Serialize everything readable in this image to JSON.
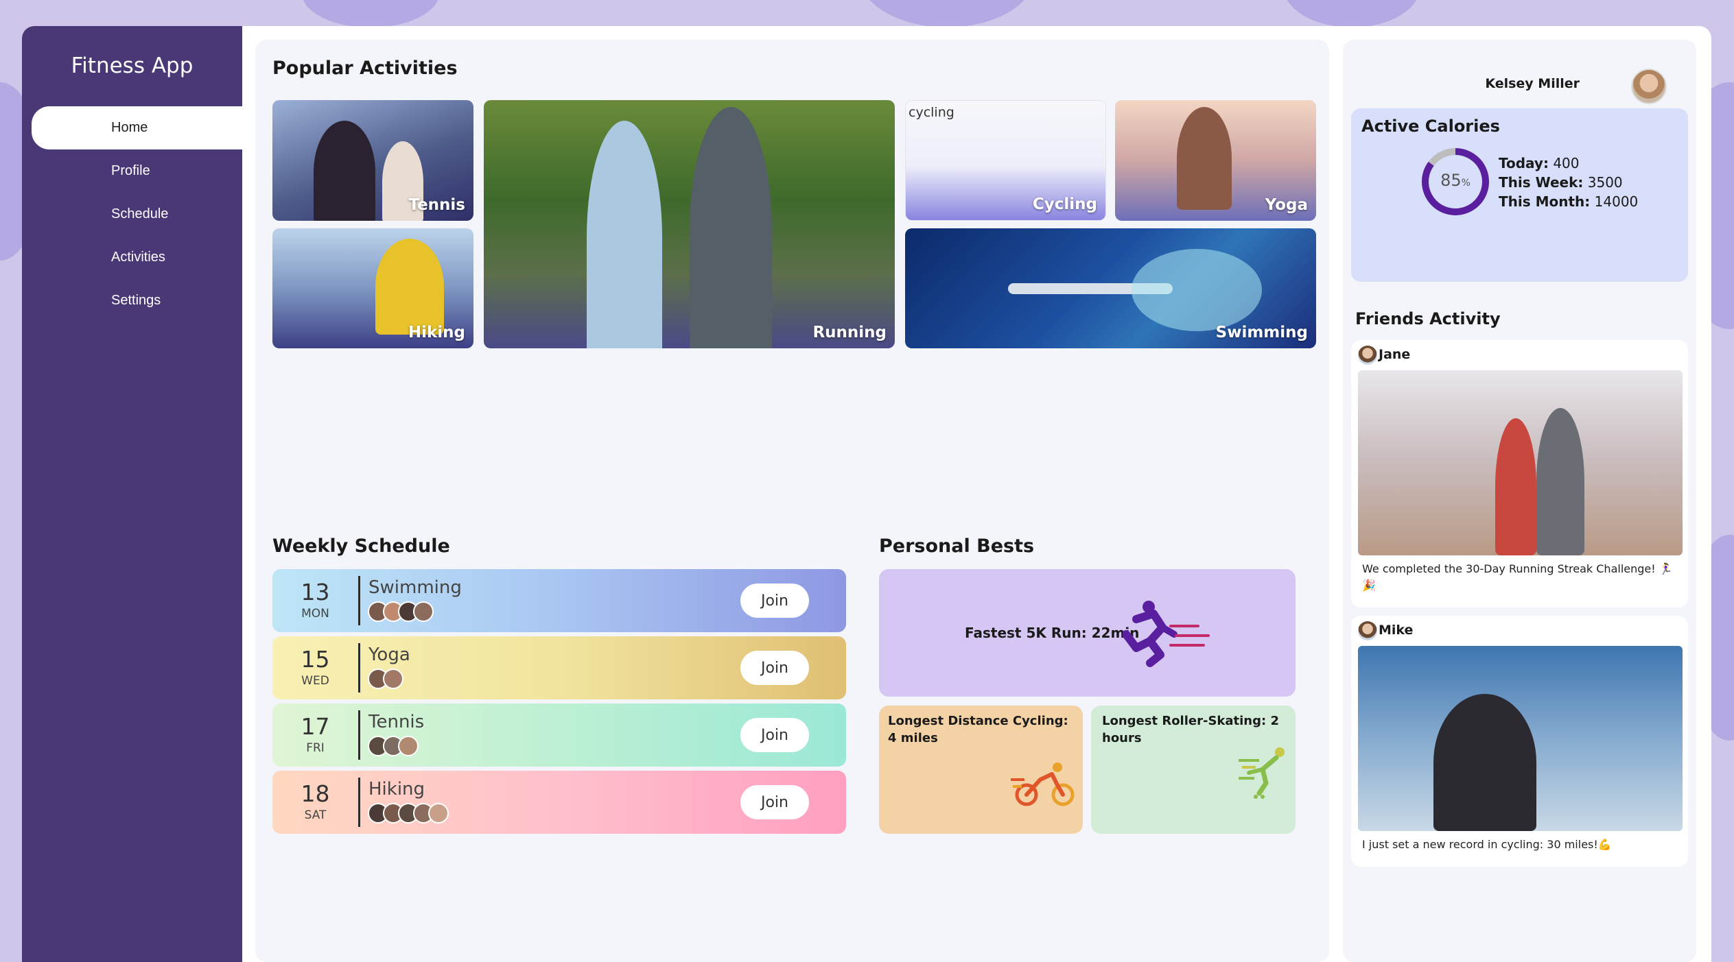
{
  "app": {
    "title": "Fitness App"
  },
  "nav": {
    "items": [
      {
        "label": "Home",
        "active": true
      },
      {
        "label": "Profile",
        "active": false
      },
      {
        "label": "Schedule",
        "active": false
      },
      {
        "label": "Activities",
        "active": false
      },
      {
        "label": "Settings",
        "active": false
      }
    ]
  },
  "popular": {
    "title": "Popular Activities",
    "tiles": [
      {
        "label": "Tennis"
      },
      {
        "label": "Running"
      },
      {
        "label": "Cycling",
        "alt_text": "cycling"
      },
      {
        "label": "Yoga"
      },
      {
        "label": "Hiking"
      },
      {
        "label": "Swimming"
      }
    ]
  },
  "schedule": {
    "title": "Weekly Schedule",
    "join_label": "Join",
    "rows": [
      {
        "day": "13",
        "dow": "MON",
        "name": "Swimming",
        "participants": 4
      },
      {
        "day": "15",
        "dow": "WED",
        "name": "Yoga",
        "participants": 2
      },
      {
        "day": "17",
        "dow": "FRI",
        "name": "Tennis",
        "participants": 3
      },
      {
        "day": "18",
        "dow": "SAT",
        "name": "Hiking",
        "participants": 5
      }
    ]
  },
  "personal_bests": {
    "title": "Personal Bests",
    "fastest": "Fastest 5K Run: 22min",
    "cycling": "Longest Distance Cycling: 4 miles",
    "skating": "Longest Roller-Skating: 2 hours"
  },
  "user": {
    "name": "Kelsey Miller"
  },
  "calories": {
    "title": "Active Calories",
    "percent": 85,
    "percent_value": "85",
    "percent_sign": "%",
    "today_label": "Today:",
    "today_value": "400",
    "week_label": "This Week:",
    "week_value": "3500",
    "month_label": "This Month:",
    "month_value": "14000"
  },
  "friends": {
    "title": "Friends Activity",
    "posts": [
      {
        "user": "Jane",
        "text": "We completed the 30-Day Running Streak Challenge! 🏃‍♀️🎉"
      },
      {
        "user": "Mike",
        "text": "I just set a new record in cycling: 30 miles!💪"
      }
    ]
  },
  "colors": {
    "sidebar": "#4a3775",
    "accent": "#5a1f9e",
    "swimming_row": "#a9c6f2",
    "yoga_row": "#f1e49e",
    "tennis_row": "#bdf0d3",
    "hiking_row": "#ffc0cc"
  }
}
